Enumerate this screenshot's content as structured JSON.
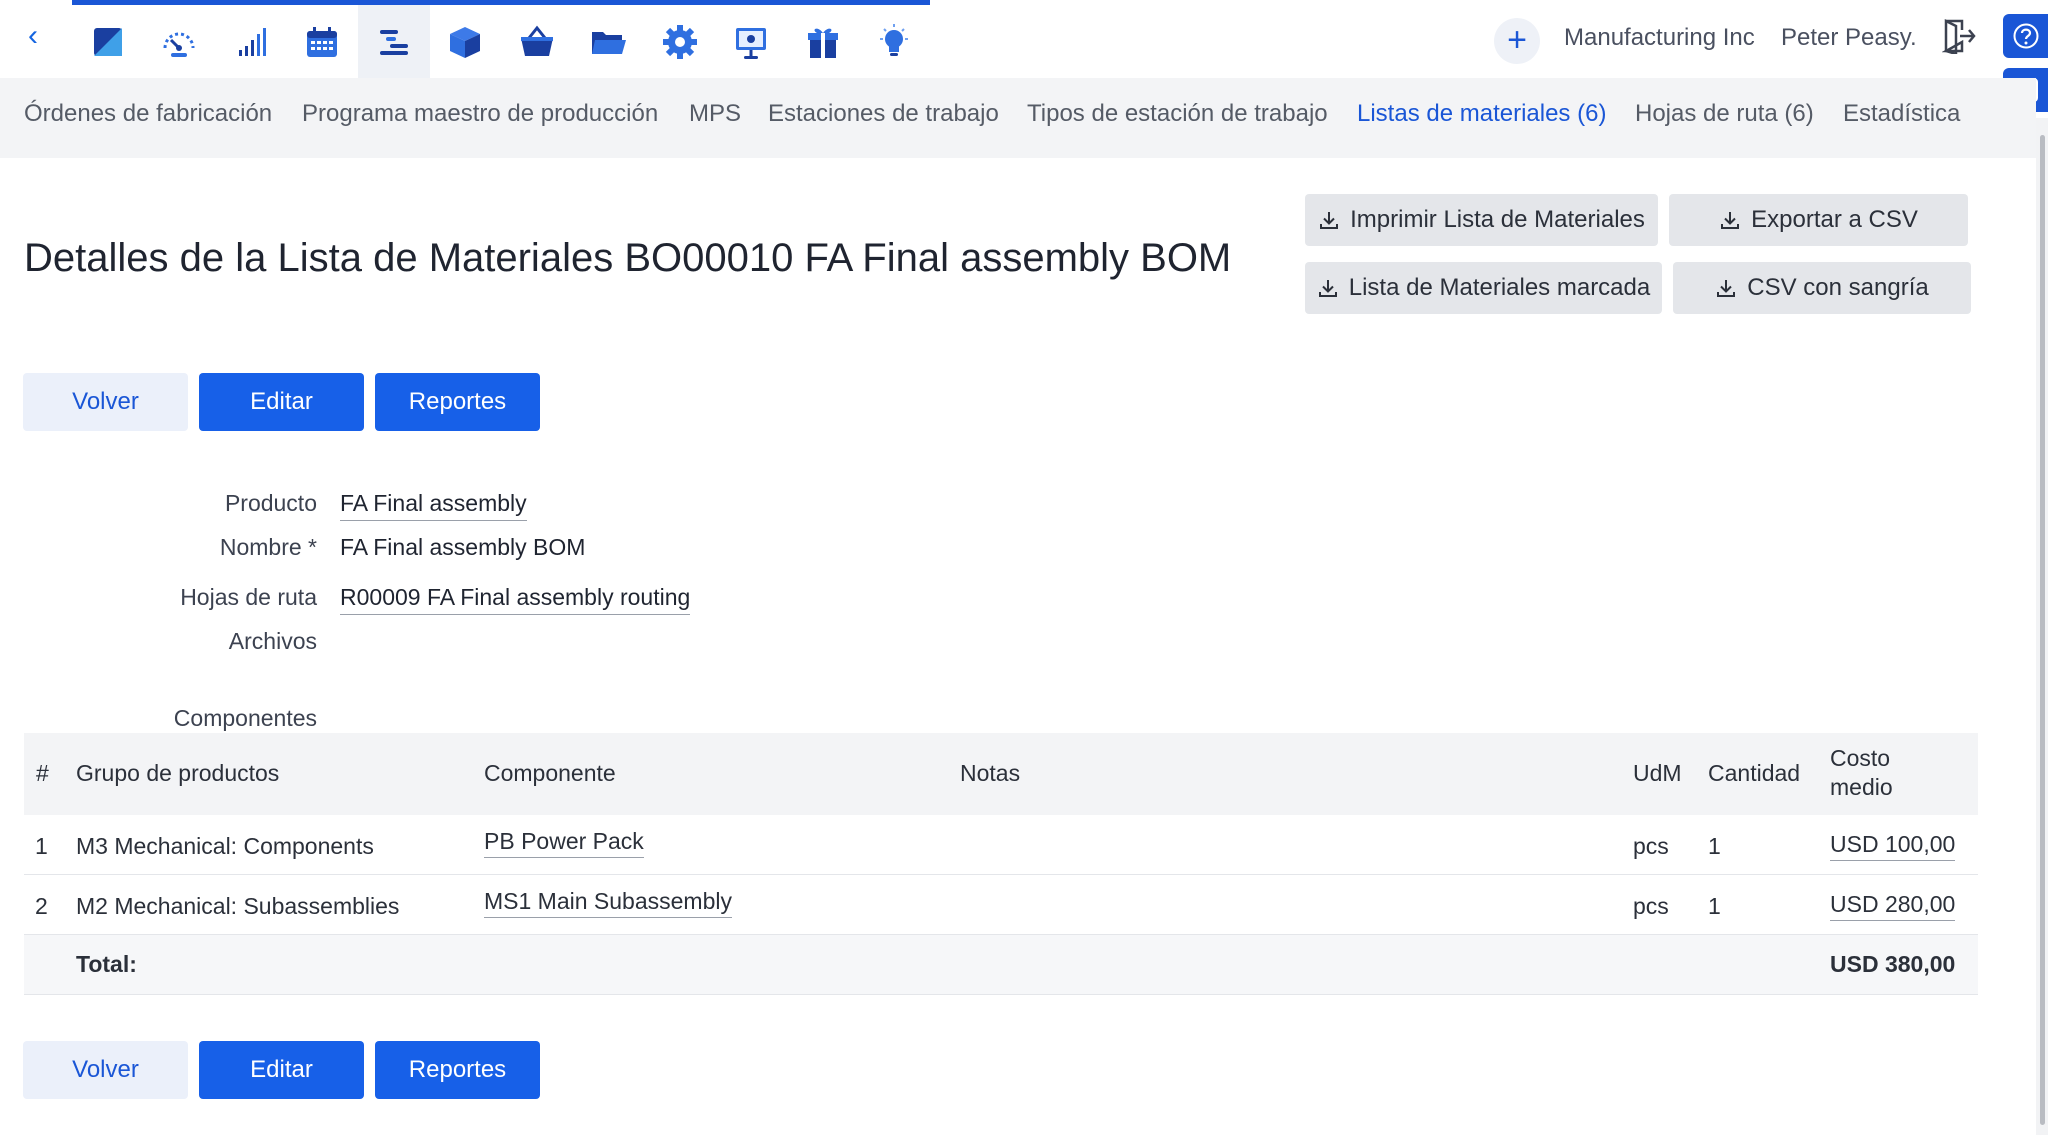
{
  "modules": [
    {
      "name": "logo-icon",
      "color": "#1a3fa0"
    },
    {
      "name": "dashboard-gauge-icon",
      "color": "#2f6fe0"
    },
    {
      "name": "bar-chart-icon",
      "color": "#1a3fa0"
    },
    {
      "name": "calendar-icon",
      "color": "#2f6fe0"
    },
    {
      "name": "production-planning-icon",
      "color": "#1a3fa0"
    },
    {
      "name": "inventory-box-icon",
      "color": "#1a3fa0"
    },
    {
      "name": "basket-icon",
      "color": "#1a3fa0"
    },
    {
      "name": "folder-icon",
      "color": "#1a3fa0"
    },
    {
      "name": "settings-gear-icon",
      "color": "#2f6fe0"
    },
    {
      "name": "presentation-icon",
      "color": "#2f6fe0"
    },
    {
      "name": "gift-icon",
      "color": "#1a3fa0"
    },
    {
      "name": "lightbulb-icon",
      "color": "#2f6fe0"
    }
  ],
  "header": {
    "company": "Manufacturing Inc",
    "user": "Peter Peasy."
  },
  "subnav": [
    "Órdenes de fabricación",
    "Programa maestro de producción",
    "MPS",
    "Estaciones de trabajo",
    "Tipos de estación de trabajo",
    "Listas de materiales (6)",
    "Hojas de ruta (6)",
    "Estadística"
  ],
  "page": {
    "title": "Detalles de la Lista de Materiales BO00010 FA Final assembly BOM"
  },
  "exports": {
    "print_bom": "Imprimir Lista de Materiales",
    "export_csv": "Exportar a CSV",
    "marked_bom": "Lista de Materiales marcada",
    "indented_csv": "CSV con sangría"
  },
  "actions": {
    "back": "Volver",
    "edit": "Editar",
    "reports": "Reportes"
  },
  "fields": {
    "product_label": "Producto",
    "product_value": "FA Final assembly",
    "name_label": "Nombre *",
    "name_value": "FA Final assembly BOM",
    "routing_label": "Hojas de ruta",
    "routing_value": "R00009 FA Final assembly routing",
    "files_label": "Archivos",
    "components_label": "Componentes"
  },
  "table": {
    "headers": {
      "num": "#",
      "group": "Grupo de productos",
      "component": "Componente",
      "notes": "Notas",
      "uom": "UdM",
      "qty": "Cantidad",
      "cost_line1": "Costo",
      "cost_line2": "medio"
    },
    "rows": [
      {
        "num": "1",
        "group": "M3 Mechanical: Components",
        "component": "PB Power Pack",
        "notes": "",
        "uom": "pcs",
        "qty": "1",
        "cost": "USD 100,00"
      },
      {
        "num": "2",
        "group": "M2 Mechanical: Subassemblies",
        "component": "MS1 Main Subassembly",
        "notes": "",
        "uom": "pcs",
        "qty": "1",
        "cost": "USD 280,00"
      }
    ],
    "total_label": "Total:",
    "total_value": "USD 380,00"
  }
}
